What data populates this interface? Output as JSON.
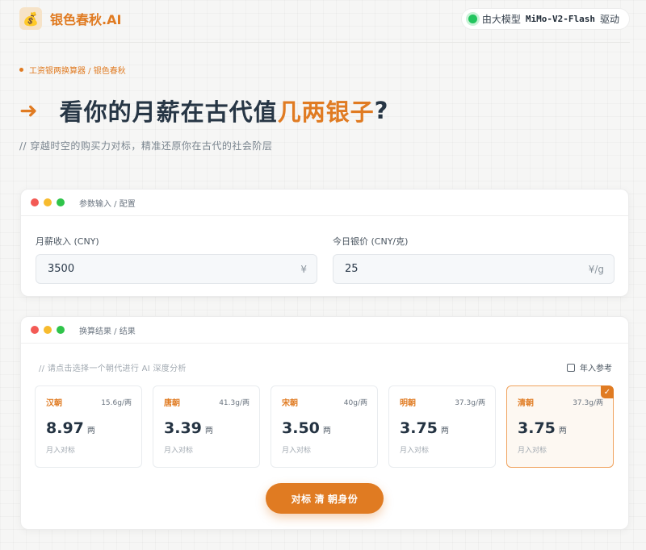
{
  "header": {
    "brand_name": "银色春秋.AI",
    "logo_icon": "money-bag-icon",
    "model_prefix": "由大模型",
    "model_name": "MiMo-V2-Flash",
    "model_suffix": "驱动"
  },
  "breadcrumb": "工资银两换算器 / 银色春秋",
  "hero": {
    "title_part1": "看你的月薪在古代值",
    "title_highlight": "几两银子",
    "title_end": "?"
  },
  "subtitle": "// 穿越时空的购买力对标，精准还原你在古代的社会阶层",
  "input_panel": {
    "title": "参数输入 / 配置",
    "salary": {
      "label": "月薪收入 (CNY)",
      "value": "3500",
      "unit": "¥"
    },
    "silver": {
      "label": "今日银价 (CNY/克)",
      "value": "25",
      "unit": "¥/g"
    }
  },
  "result_panel": {
    "title": "换算结果 / 结果",
    "hint": "// 请点击选择一个朝代进行 AI 深度分析",
    "annual_label": "年入参考",
    "annual_checked": false,
    "cards": [
      {
        "dynasty": "汉朝",
        "rate": "15.6g/两",
        "value": "8.97",
        "unit": "两",
        "desc": "月入对标",
        "selected": false
      },
      {
        "dynasty": "唐朝",
        "rate": "41.3g/两",
        "value": "3.39",
        "unit": "两",
        "desc": "月入对标",
        "selected": false
      },
      {
        "dynasty": "宋朝",
        "rate": "40g/两",
        "value": "3.50",
        "unit": "两",
        "desc": "月入对标",
        "selected": false
      },
      {
        "dynasty": "明朝",
        "rate": "37.3g/两",
        "value": "3.75",
        "unit": "两",
        "desc": "月入对标",
        "selected": false
      },
      {
        "dynasty": "清朝",
        "rate": "37.3g/两",
        "value": "3.75",
        "unit": "两",
        "desc": "月入对标",
        "selected": true
      }
    ],
    "cta_label": "对标 清 朝身份"
  },
  "colors": {
    "accent": "#e07b22",
    "live": "#22c55e"
  }
}
